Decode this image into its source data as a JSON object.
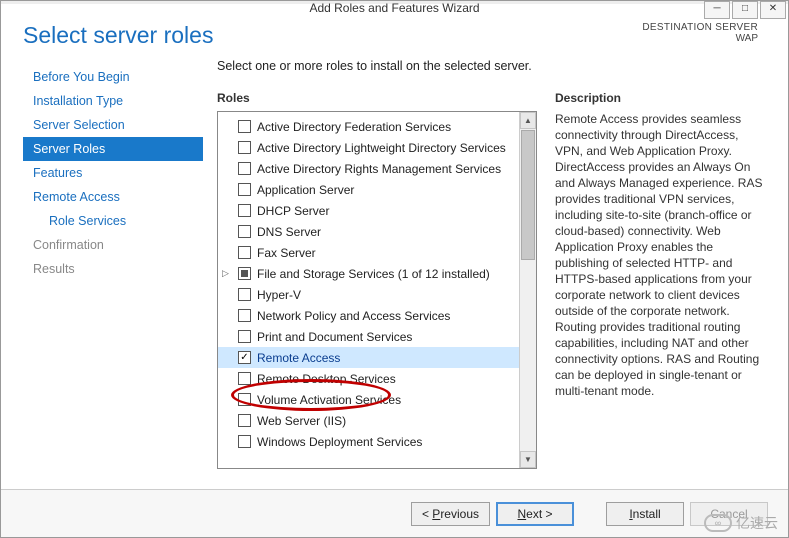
{
  "window": {
    "title": "Add Roles and Features Wizard",
    "dest_label": "DESTINATION SERVER",
    "dest_value": "WAP"
  },
  "header": {
    "title": "Select server roles"
  },
  "nav": {
    "items": [
      {
        "label": "Before You Begin",
        "state": "normal"
      },
      {
        "label": "Installation Type",
        "state": "normal"
      },
      {
        "label": "Server Selection",
        "state": "normal"
      },
      {
        "label": "Server Roles",
        "state": "active"
      },
      {
        "label": "Features",
        "state": "normal"
      },
      {
        "label": "Remote Access",
        "state": "normal"
      },
      {
        "label": "Role Services",
        "state": "sub"
      },
      {
        "label": "Confirmation",
        "state": "disabled"
      },
      {
        "label": "Results",
        "state": "disabled"
      }
    ]
  },
  "content": {
    "instruction": "Select one or more roles to install on the selected server.",
    "roles_title": "Roles",
    "desc_title": "Description",
    "roles": [
      {
        "label": "Active Directory Federation Services",
        "checked": false
      },
      {
        "label": "Active Directory Lightweight Directory Services",
        "checked": false
      },
      {
        "label": "Active Directory Rights Management Services",
        "checked": false
      },
      {
        "label": "Application Server",
        "checked": false
      },
      {
        "label": "DHCP Server",
        "checked": false
      },
      {
        "label": "DNS Server",
        "checked": false
      },
      {
        "label": "Fax Server",
        "checked": false
      },
      {
        "label": "File and Storage Services (1 of 12 installed)",
        "checked": "partial",
        "expandable": true
      },
      {
        "label": "Hyper-V",
        "checked": false
      },
      {
        "label": "Network Policy and Access Services",
        "checked": false
      },
      {
        "label": "Print and Document Services",
        "checked": false
      },
      {
        "label": "Remote Access",
        "checked": true,
        "selected": true,
        "highlighted": true
      },
      {
        "label": "Remote Desktop Services",
        "checked": false
      },
      {
        "label": "Volume Activation Services",
        "checked": false
      },
      {
        "label": "Web Server (IIS)",
        "checked": false
      },
      {
        "label": "Windows Deployment Services",
        "checked": false
      }
    ],
    "description": "Remote Access provides seamless connectivity through DirectAccess, VPN, and Web Application Proxy. DirectAccess provides an Always On and Always Managed experience. RAS provides traditional VPN services, including site-to-site (branch-office or cloud-based) connectivity. Web Application Proxy enables the publishing of selected HTTP- and HTTPS-based applications from your corporate network to client devices outside of the corporate network. Routing provides traditional routing capabilities, including NAT and other connectivity options. RAS and Routing can be deployed in single-tenant or multi-tenant mode."
  },
  "footer": {
    "previous": "Previous",
    "next": "Next >",
    "install": "Install",
    "cancel": "Cancel"
  },
  "watermark": "亿速云"
}
